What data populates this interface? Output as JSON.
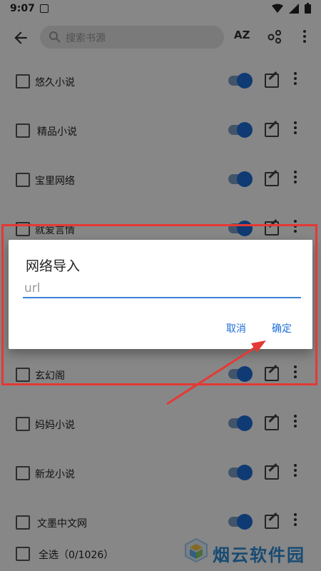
{
  "status_bar": {
    "time": "9:07"
  },
  "toolbar": {
    "search_placeholder": "搜索书源",
    "sort_label": "AZ",
    "group_label": "ᵒᵒ"
  },
  "sources": [
    {
      "name": "悠久小说",
      "enabled": true
    },
    {
      "name": "精品小说",
      "enabled": true
    },
    {
      "name": "宝里网络",
      "enabled": true
    },
    {
      "name": "就爱言情",
      "enabled": true
    },
    {
      "name": "玄幻阁",
      "enabled": true
    },
    {
      "name": "妈妈小说",
      "enabled": true
    },
    {
      "name": "新龙小说",
      "enabled": true
    },
    {
      "name": "文墨中文网",
      "enabled": true
    }
  ],
  "bottom_bar": {
    "select_all_label": "全选（0/1026）"
  },
  "dialog": {
    "title": "网络导入",
    "input_placeholder": "url",
    "cancel_label": "取消",
    "confirm_label": "确定"
  },
  "watermark": {
    "text": "烟云软件园"
  },
  "colors": {
    "accent": "#1e6fd9",
    "annotation": "#e53935"
  }
}
